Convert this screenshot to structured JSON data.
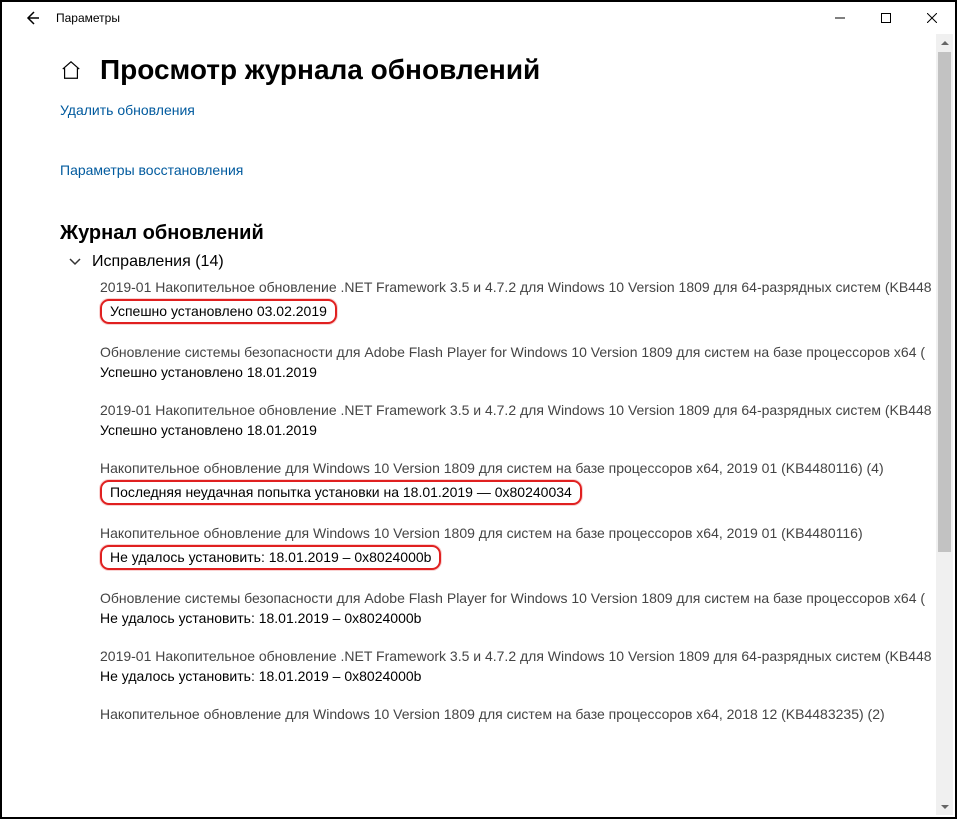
{
  "titlebar": {
    "title": "Параметры"
  },
  "page": {
    "title": "Просмотр журнала обновлений",
    "links": {
      "uninstall": "Удалить обновления",
      "recovery": "Параметры восстановления"
    },
    "section_title": "Журнал обновлений",
    "group": {
      "label": "Исправления (14)"
    }
  },
  "items": [
    {
      "name": "2019-01 Накопительное обновление .NET Framework 3.5 и 4.7.2 для Windows 10 Version 1809 для 64-разрядных систем (KB448",
      "status": "Успешно установлено 03.02.2019",
      "highlight": true
    },
    {
      "name": "Обновление системы безопасности для Adobe Flash Player for Windows 10 Version 1809 для систем на базе процессоров x64 (",
      "status": "Успешно установлено 18.01.2019",
      "highlight": false
    },
    {
      "name": "2019-01 Накопительное обновление .NET Framework 3.5 и 4.7.2 для Windows 10 Version 1809 для 64-разрядных систем (KB448",
      "status": "Успешно установлено 18.01.2019",
      "highlight": false
    },
    {
      "name": "Накопительное обновление для Windows 10 Version 1809 для систем на базе процессоров x64, 2019 01 (KB4480116) (4)",
      "status": "Последняя неудачная попытка установки на 18.01.2019 — 0x80240034",
      "highlight": true
    },
    {
      "name": "Накопительное обновление для Windows 10 Version 1809 для систем на базе процессоров x64, 2019 01 (KB4480116)",
      "status": "Не удалось установить: 18.01.2019 – 0x8024000b",
      "highlight": true
    },
    {
      "name": "Обновление системы безопасности для Adobe Flash Player for Windows 10 Version 1809 для систем на базе процессоров x64 (",
      "status": "Не удалось установить: 18.01.2019 – 0x8024000b",
      "highlight": false
    },
    {
      "name": "2019-01 Накопительное обновление .NET Framework 3.5 и 4.7.2 для Windows 10 Version 1809 для 64-разрядных систем (KB448",
      "status": "Не удалось установить: 18.01.2019 – 0x8024000b",
      "highlight": false
    },
    {
      "name": "Накопительное обновление для Windows 10 Version 1809 для систем на базе процессоров x64, 2018 12 (KB4483235) (2)",
      "status": "",
      "highlight": false
    }
  ]
}
